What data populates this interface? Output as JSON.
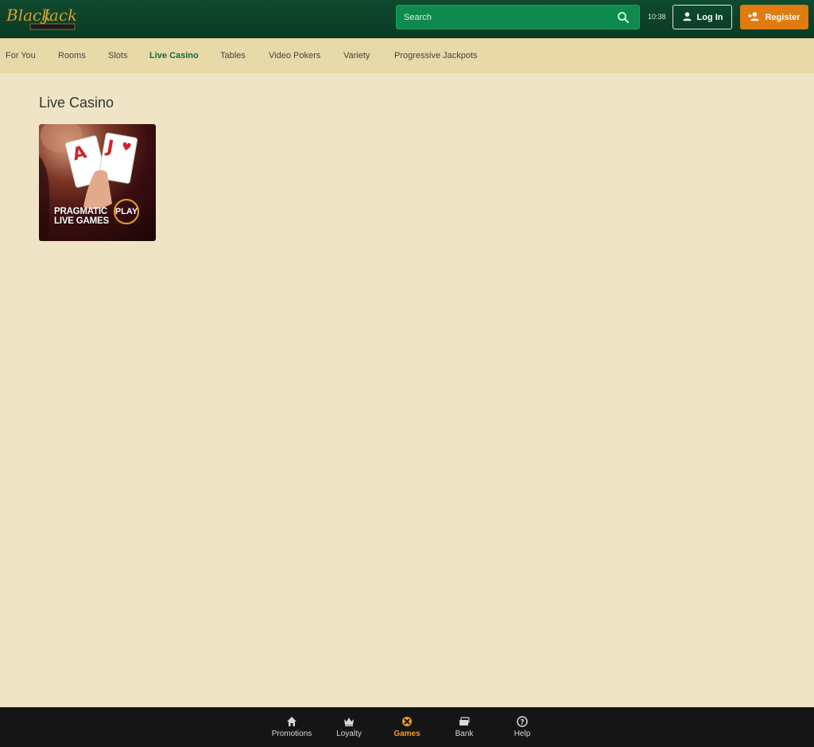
{
  "header": {
    "logo_text": "BlackJack Ballroom Casino",
    "search": {
      "placeholder": "Search",
      "value": ""
    },
    "clock": "10:38",
    "login_label": "Log In",
    "register_label": "Register",
    "colors": {
      "header_bg": "#0b3a24",
      "search_bg": "#0f8a4e",
      "register_bg": "#e07b0f"
    }
  },
  "categories": {
    "items": [
      {
        "label": "For You",
        "active": false
      },
      {
        "label": "Rooms",
        "active": false
      },
      {
        "label": "Slots",
        "active": false
      },
      {
        "label": "Live Casino",
        "active": true
      },
      {
        "label": "Tables",
        "active": false
      },
      {
        "label": "Video Pokers",
        "active": false
      },
      {
        "label": "Variety",
        "active": false
      },
      {
        "label": "Progressive Jackpots",
        "active": false
      }
    ]
  },
  "main": {
    "section_title": "Live Casino",
    "games": [
      {
        "title_line1": "PRAGMATIC",
        "title_line2": "LIVE GAMES",
        "badge": "PLAY"
      }
    ]
  },
  "bottom_nav": {
    "items": [
      {
        "label": "Promotions",
        "icon": "home-icon",
        "active": false
      },
      {
        "label": "Loyalty",
        "icon": "crown-icon",
        "active": false
      },
      {
        "label": "Games",
        "icon": "games-icon",
        "active": true
      },
      {
        "label": "Bank",
        "icon": "bank-icon",
        "active": false
      },
      {
        "label": "Help",
        "icon": "help-icon",
        "active": false
      }
    ],
    "active_color": "#f0a020"
  }
}
